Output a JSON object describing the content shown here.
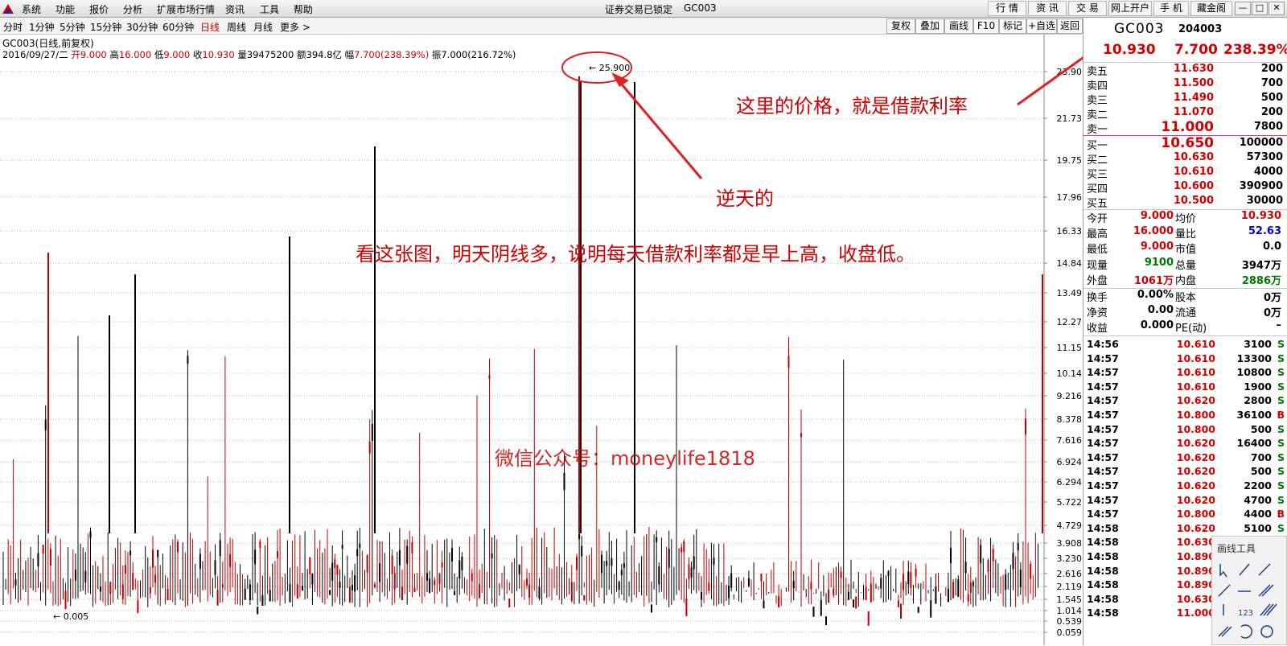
{
  "menubar": {
    "items": [
      "系统",
      "功能",
      "报价",
      "分析",
      "扩展市场行情",
      "资讯",
      "工具",
      "帮助"
    ],
    "status": "证券交易已锁定",
    "code": "GC003",
    "right_buttons": [
      "行 情",
      "资 讯",
      "交 易",
      "网上开户",
      "手 机",
      "藏金阁"
    ],
    "window_controls": [
      "—",
      "□",
      "✕"
    ]
  },
  "periodbar": {
    "periods": [
      "分时",
      "1分钟",
      "5分钟",
      "15分钟",
      "30分钟",
      "60分钟",
      "日线",
      "周线",
      "月线",
      "更多 >"
    ],
    "active": "日线",
    "tools": [
      "复权",
      "叠加",
      "画线",
      "F10",
      "标记",
      "+自选",
      "返回"
    ]
  },
  "chart": {
    "title": "GC003(日线,前复权)",
    "info": {
      "date": "2016/09/27/二",
      "open_label": "开",
      "open": "9.000",
      "high_label": "高",
      "high": "16.000",
      "low_label": "低",
      "low": "9.000",
      "close_label": "收",
      "close": "10.930",
      "vol_label": "量",
      "vol": "39475200",
      "amt_label": "额",
      "amt": "394.8亿",
      "chg_label": "幅",
      "chg": "7.700(238.39%)",
      "amp_label": "振",
      "amp": "7.000(216.72%)"
    },
    "max_label": "25.900",
    "min_label": "0.005",
    "y_ticks": [
      "23.90",
      "21.73",
      "19.75",
      "17.96",
      "16.33",
      "14.84",
      "13.49",
      "12.27",
      "11.15",
      "10.14",
      "9.216",
      "8.378",
      "7.616",
      "6.924",
      "6.294",
      "5.722",
      "4.729",
      "3.908",
      "3.230",
      "2.616",
      "2.119",
      "1.545",
      "1.014",
      "0.539",
      "0.059"
    ]
  },
  "annotations": {
    "a1": "这里的价格，就是借款利率",
    "a2": "逆天的",
    "a3": "看这张图，明天阴线多，说明每天借款利率都是早上高，收盘低。",
    "watermark": "微信公众号：moneylife1818"
  },
  "quote": {
    "name": "GC003",
    "code": "204003",
    "price": "10.930",
    "change": "7.700",
    "pct": "238.39%",
    "asks": [
      {
        "label": "卖五",
        "price": "11.630",
        "vol": "200"
      },
      {
        "label": "卖四",
        "price": "11.500",
        "vol": "700"
      },
      {
        "label": "卖三",
        "price": "11.490",
        "vol": "500"
      },
      {
        "label": "卖二",
        "price": "11.070",
        "vol": "200"
      },
      {
        "label": "卖一",
        "price": "11.000",
        "vol": "7800"
      }
    ],
    "bids": [
      {
        "label": "买一",
        "price": "10.650",
        "vol": "100000"
      },
      {
        "label": "买二",
        "price": "10.630",
        "vol": "57300"
      },
      {
        "label": "买三",
        "price": "10.610",
        "vol": "4000"
      },
      {
        "label": "买四",
        "price": "10.600",
        "vol": "390900"
      },
      {
        "label": "买五",
        "price": "10.500",
        "vol": "30000"
      }
    ],
    "stats": [
      [
        "今开",
        "9.000",
        "均价",
        "10.930"
      ],
      [
        "最高",
        "16.000",
        "量比",
        "52.63"
      ],
      [
        "最低",
        "9.000",
        "市值",
        "0.0"
      ],
      [
        "现量",
        "9100",
        "总量",
        "3947万"
      ],
      [
        "外盘",
        "1061万",
        "内盘",
        "2886万"
      ],
      [
        "换手",
        "0.00%",
        "股本",
        "0万"
      ],
      [
        "净资",
        "0.00",
        "流通",
        "0万"
      ],
      [
        "收益",
        "0.000",
        "PE(动)",
        "–"
      ]
    ],
    "ticks": [
      [
        "14:56",
        "10.610",
        "3100",
        "S"
      ],
      [
        "14:57",
        "10.610",
        "13300",
        "S"
      ],
      [
        "14:57",
        "10.610",
        "10800",
        "S"
      ],
      [
        "14:57",
        "10.610",
        "1900",
        "S"
      ],
      [
        "14:57",
        "10.620",
        "2800",
        "S"
      ],
      [
        "14:57",
        "10.800",
        "36100",
        "B"
      ],
      [
        "14:57",
        "10.800",
        "500",
        "S"
      ],
      [
        "14:57",
        "10.620",
        "16400",
        "S"
      ],
      [
        "14:57",
        "10.620",
        "700",
        "S"
      ],
      [
        "14:57",
        "10.620",
        "500",
        "S"
      ],
      [
        "14:57",
        "10.620",
        "2200",
        "S"
      ],
      [
        "14:57",
        "10.620",
        "4700",
        "S"
      ],
      [
        "14:57",
        "10.800",
        "4400",
        "B"
      ],
      [
        "14:58",
        "10.620",
        "5100",
        "S"
      ],
      [
        "14:58",
        "10.630",
        "",
        ""
      ],
      [
        "14:58",
        "10.890",
        "",
        ""
      ],
      [
        "14:58",
        "10.890",
        "",
        ""
      ],
      [
        "14:58",
        "10.890",
        "",
        ""
      ],
      [
        "14:58",
        "10.630",
        "",
        ""
      ],
      [
        "14:58",
        "11.000",
        "",
        ""
      ]
    ]
  },
  "drawtools": {
    "header": "画线工具"
  },
  "colors": {
    "up": "#d00000",
    "down": "#000000",
    "accent_red": "#d00000"
  }
}
